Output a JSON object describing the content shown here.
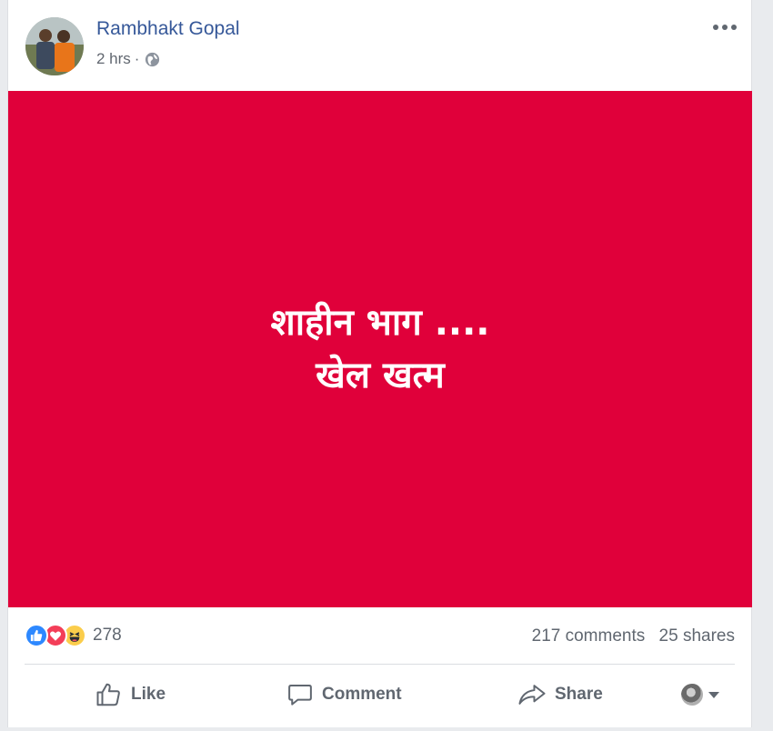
{
  "post": {
    "author": "Rambhakt Gopal",
    "timestamp": "2 hrs",
    "separator": "·",
    "audience_icon": "globe-icon",
    "more_icon": "more-options-icon",
    "image": {
      "background_color": "#e0003a",
      "text_color": "#ffffff",
      "lines": [
        "शाहीन भाग ....",
        "खेल खत्म"
      ]
    }
  },
  "stats": {
    "reaction_icons": [
      "like-reaction-icon",
      "love-reaction-icon",
      "haha-reaction-icon"
    ],
    "reaction_count": "278",
    "comments": "217 comments",
    "shares": "25 shares"
  },
  "actions": {
    "like_label": "Like",
    "comment_label": "Comment",
    "share_label": "Share"
  },
  "colors": {
    "link": "#365899",
    "secondary_text": "#606770",
    "like_blue": "#2d88ff",
    "love_red": "#f33e58",
    "haha_yellow": "#fbcd4b"
  }
}
